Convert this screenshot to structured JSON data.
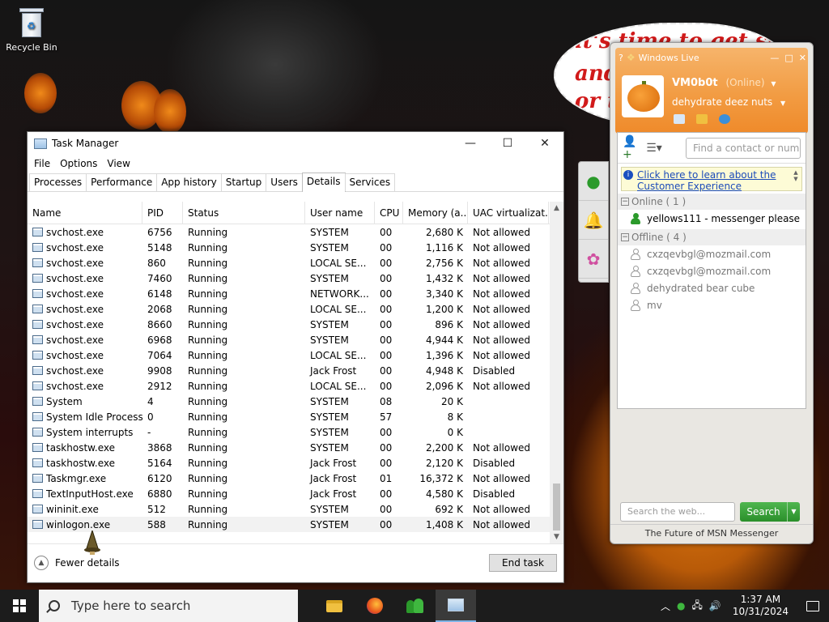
{
  "desktop": {
    "recycle_bin_label": "Recycle Bin",
    "bubble_lines": [
      "it's time to get shit",
      "and",
      "or t"
    ]
  },
  "task_manager": {
    "title": "Task Manager",
    "menu": [
      "File",
      "Options",
      "View"
    ],
    "tabs": [
      "Processes",
      "Performance",
      "App history",
      "Startup",
      "Users",
      "Details",
      "Services"
    ],
    "active_tab": "Details",
    "columns": [
      "Name",
      "PID",
      "Status",
      "User name",
      "CPU",
      "Memory (a...",
      "UAC virtualizat..."
    ],
    "rows": [
      [
        "svchost.exe",
        "6756",
        "Running",
        "SYSTEM",
        "00",
        "2,680 K",
        "Not allowed"
      ],
      [
        "svchost.exe",
        "5148",
        "Running",
        "SYSTEM",
        "00",
        "1,116 K",
        "Not allowed"
      ],
      [
        "svchost.exe",
        "860",
        "Running",
        "LOCAL SE...",
        "00",
        "2,756 K",
        "Not allowed"
      ],
      [
        "svchost.exe",
        "7460",
        "Running",
        "SYSTEM",
        "00",
        "1,432 K",
        "Not allowed"
      ],
      [
        "svchost.exe",
        "6148",
        "Running",
        "NETWORK...",
        "00",
        "3,340 K",
        "Not allowed"
      ],
      [
        "svchost.exe",
        "2068",
        "Running",
        "LOCAL SE...",
        "00",
        "1,200 K",
        "Not allowed"
      ],
      [
        "svchost.exe",
        "8660",
        "Running",
        "SYSTEM",
        "00",
        "896 K",
        "Not allowed"
      ],
      [
        "svchost.exe",
        "6968",
        "Running",
        "SYSTEM",
        "00",
        "4,944 K",
        "Not allowed"
      ],
      [
        "svchost.exe",
        "7064",
        "Running",
        "LOCAL SE...",
        "00",
        "1,396 K",
        "Not allowed"
      ],
      [
        "svchost.exe",
        "9908",
        "Running",
        "Jack Frost",
        "00",
        "4,948 K",
        "Disabled"
      ],
      [
        "svchost.exe",
        "2912",
        "Running",
        "LOCAL SE...",
        "00",
        "2,096 K",
        "Not allowed"
      ],
      [
        "System",
        "4",
        "Running",
        "SYSTEM",
        "08",
        "20 K",
        ""
      ],
      [
        "System Idle Process",
        "0",
        "Running",
        "SYSTEM",
        "57",
        "8 K",
        ""
      ],
      [
        "System interrupts",
        "-",
        "Running",
        "SYSTEM",
        "00",
        "0 K",
        ""
      ],
      [
        "taskhostw.exe",
        "3868",
        "Running",
        "SYSTEM",
        "00",
        "2,200 K",
        "Not allowed"
      ],
      [
        "taskhostw.exe",
        "5164",
        "Running",
        "Jack Frost",
        "00",
        "2,120 K",
        "Disabled"
      ],
      [
        "Taskmgr.exe",
        "6120",
        "Running",
        "Jack Frost",
        "01",
        "16,372 K",
        "Not allowed"
      ],
      [
        "TextInputHost.exe",
        "6880",
        "Running",
        "Jack Frost",
        "00",
        "4,580 K",
        "Disabled"
      ],
      [
        "wininit.exe",
        "512",
        "Running",
        "SYSTEM",
        "00",
        "692 K",
        "Not allowed"
      ],
      [
        "winlogon.exe",
        "588",
        "Running",
        "SYSTEM",
        "00",
        "1,408 K",
        "Not allowed"
      ]
    ],
    "fewer_details_label": "Fewer details",
    "end_task_label": "End task"
  },
  "msn": {
    "title": "Windows Live",
    "display_name": "VM0b0t",
    "status": "(Online)",
    "personal_message": "dehydrate deez nuts",
    "find_placeholder": "Find a contact or number...",
    "banner_text": "Click here to learn about the Customer Experience",
    "online_group": "Online ( 1 )",
    "online_contacts": [
      "yellows111 - messenger please"
    ],
    "offline_group": "Offline ( 4 )",
    "offline_contacts": [
      "cxzqevbgl@mozmail.com",
      "cxzqevbgl@mozmail.com",
      "dehydrated bear cube",
      "mv"
    ],
    "web_search_placeholder": "Search the web...",
    "search_label": "Search",
    "footer": "The Future of MSN Messenger"
  },
  "taskbar": {
    "search_placeholder": "Type here to search",
    "time": "1:37 AM",
    "date": "10/31/2024"
  }
}
